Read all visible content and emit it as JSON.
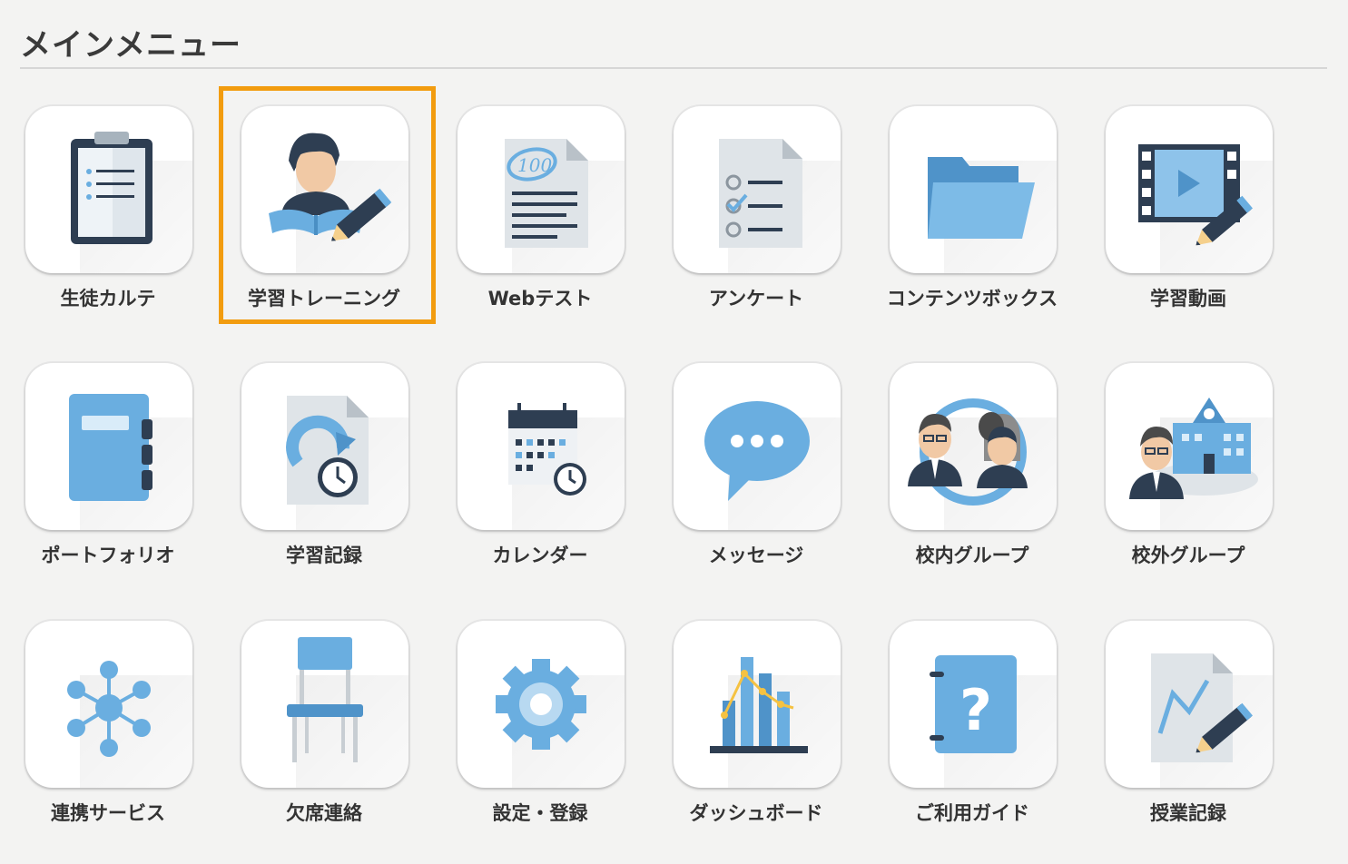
{
  "header": {
    "title": "メインメニュー"
  },
  "menu": [
    {
      "label": "生徒カルテ",
      "icon": "clipboard-icon"
    },
    {
      "label": "学習トレーニング",
      "icon": "student-study-icon",
      "selected": true
    },
    {
      "label": "Webテスト",
      "icon": "test-paper-icon"
    },
    {
      "label": "アンケート",
      "icon": "checklist-icon"
    },
    {
      "label": "コンテンツボックス",
      "icon": "folder-icon"
    },
    {
      "label": "学習動画",
      "icon": "video-edit-icon"
    },
    {
      "label": "ポートフォリオ",
      "icon": "notebook-icon"
    },
    {
      "label": "学習記録",
      "icon": "record-history-icon"
    },
    {
      "label": "カレンダー",
      "icon": "calendar-icon"
    },
    {
      "label": "メッセージ",
      "icon": "chat-bubble-icon"
    },
    {
      "label": "校内グループ",
      "icon": "school-group-icon"
    },
    {
      "label": "校外グループ",
      "icon": "external-group-icon"
    },
    {
      "label": "連携サービス",
      "icon": "network-icon"
    },
    {
      "label": "欠席連絡",
      "icon": "chair-icon"
    },
    {
      "label": "設定・登録",
      "icon": "gear-icon"
    },
    {
      "label": "ダッシュボード",
      "icon": "bar-chart-icon"
    },
    {
      "label": "ご利用ガイド",
      "icon": "help-book-icon"
    },
    {
      "label": "授業記録",
      "icon": "lesson-record-icon"
    }
  ],
  "colors": {
    "accent": "#f29c0f",
    "icon_blue": "#6aaee0",
    "icon_dark": "#2e3e52"
  }
}
